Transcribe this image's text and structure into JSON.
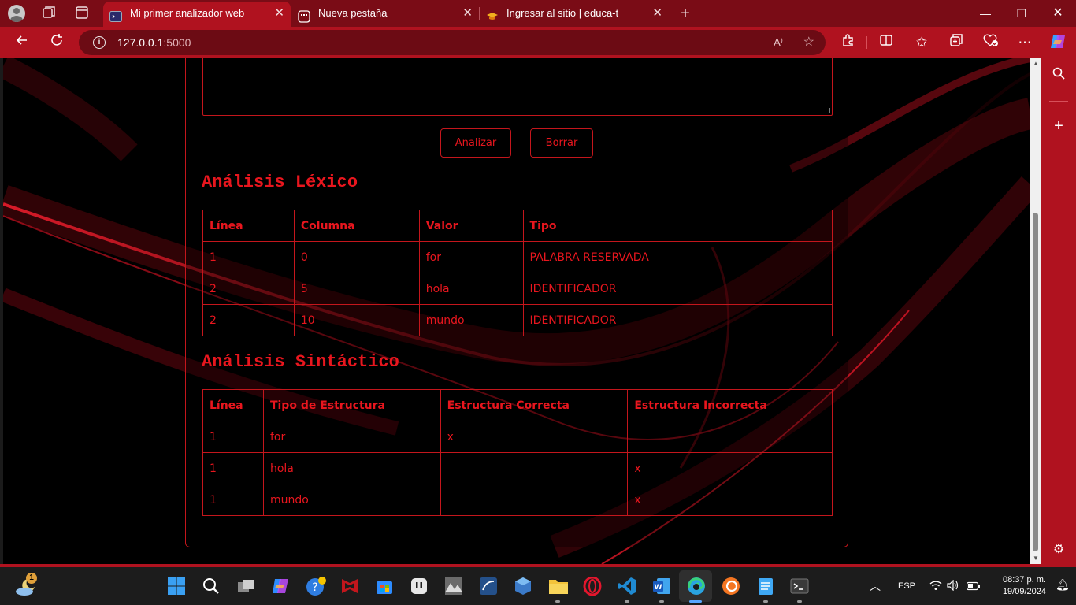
{
  "browser": {
    "tabs": [
      {
        "title": "Mi primer analizador web",
        "active": true,
        "icon": "terminal-icon"
      },
      {
        "title": "Nueva pestaña",
        "active": false,
        "icon": "newtab-icon"
      },
      {
        "title": "Ingresar al sitio | educa-t",
        "active": false,
        "icon": "graduation-cap-icon"
      }
    ],
    "url_host": "127.0.0.1",
    "url_port": ":5000",
    "read_aloud_label": "A⁾",
    "accent_color": "#b0121f"
  },
  "page": {
    "buttons": {
      "analyze": "Analizar",
      "clear": "Borrar"
    },
    "lexical": {
      "title": "Análisis Léxico",
      "headers": [
        "Línea",
        "Columna",
        "Valor",
        "Tipo"
      ],
      "rows": [
        [
          "1",
          "0",
          "for",
          "PALABRA RESERVADA"
        ],
        [
          "2",
          "5",
          "hola",
          "IDENTIFICADOR"
        ],
        [
          "2",
          "10",
          "mundo",
          "IDENTIFICADOR"
        ]
      ]
    },
    "syntactic": {
      "title": "Análisis Sintáctico",
      "headers": [
        "Línea",
        "Tipo de Estructura",
        "Estructura Correcta",
        "Estructura Incorrecta"
      ],
      "rows": [
        [
          "1",
          "for",
          "x",
          ""
        ],
        [
          "1",
          "hola",
          "",
          "x"
        ],
        [
          "1",
          "mundo",
          "",
          "x"
        ]
      ]
    },
    "text_color": "#e8161e"
  },
  "taskbar": {
    "weather_badge": "1",
    "language": "ESP",
    "time": "08:37 p. m.",
    "date": "19/09/2024"
  }
}
